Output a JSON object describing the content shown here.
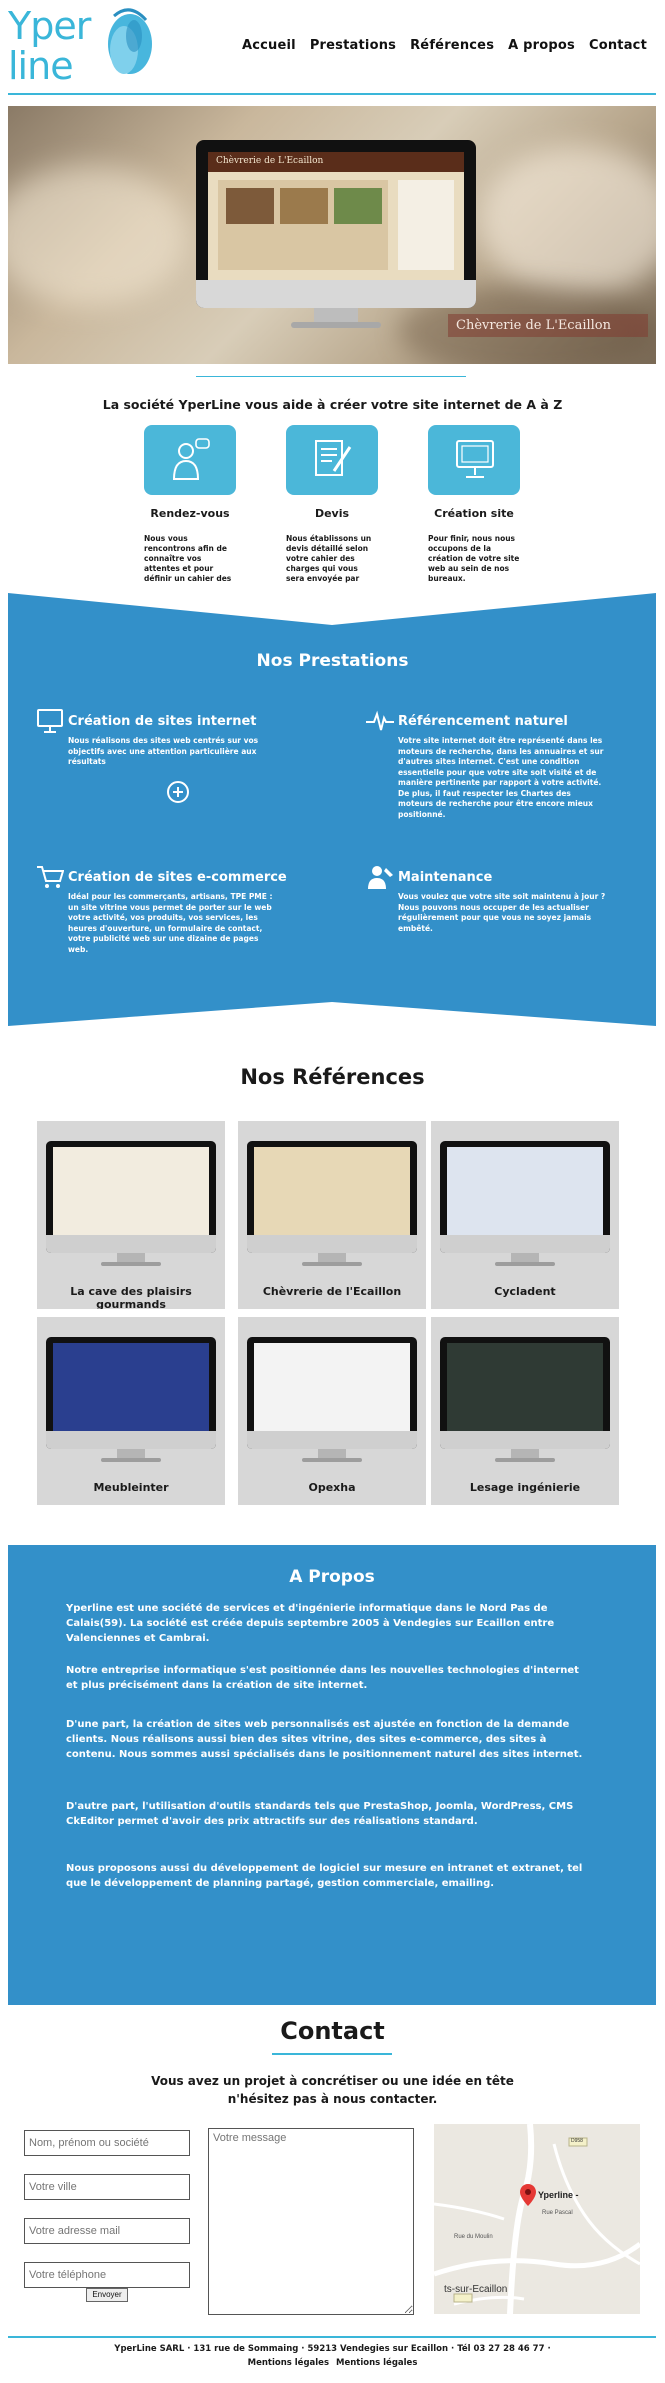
{
  "header": {
    "logo_text_top": "Yper",
    "logo_text_bottom": "line",
    "nav": [
      "Accueil",
      "Prestations",
      "Références",
      "A propos",
      "Contact"
    ]
  },
  "hero": {
    "caption": "Chèvrerie de L'Ecaillon",
    "screen_title": "Chèvrerie de L'Ecaillon"
  },
  "intro": {
    "title": "La société YperLine vous aide à créer votre site internet de A à Z",
    "features": [
      {
        "icon": "person-chat-icon",
        "title": "Rendez-vous",
        "text": "Nous vous rencontrons afin de connaître vos attentes et pour définir un cahier des"
      },
      {
        "icon": "document-pen-icon",
        "title": "Devis",
        "text": "Nous établissons un devis détaillé selon votre cahier des charges qui vous sera envoyée par email."
      },
      {
        "icon": "monitor-icon",
        "title": "Création site",
        "text": "Pour finir, nous nous occupons de la création de votre site web au sein de nos bureaux."
      }
    ]
  },
  "prestations": {
    "title": "Nos Prestations",
    "services": [
      {
        "icon": "computer-icon",
        "title": "Création de sites internet",
        "text": "Nous réalisons des sites web centrés sur vos objectifs avec une attention particulière aux résultats"
      },
      {
        "icon": "heartbeat-icon",
        "title": "Référencement naturel",
        "text": "Votre site internet doit être représenté dans les moteurs de recherche, dans les annuaires et sur d'autres sites internet. C'est une condition essentielle pour que votre site soit visité et de manière pertinente par rapport à votre activité. De plus, il faut respecter les Chartes des moteurs de recherche pour être encore mieux positionné."
      },
      {
        "icon": "cart-icon",
        "title": "Création de sites e-commerce",
        "text": "Idéal pour les commerçants, artisans, TPE PME : un site vitrine vous permet de porter sur le web votre activité, vos produits, vos services, les heures d'ouverture, un formulaire de contact, votre publicité web sur une dizaine de pages web."
      },
      {
        "icon": "maintenance-icon",
        "title": "Maintenance",
        "text": "Vous voulez que votre site soit maintenu à jour ? Nous pouvons nous occuper de les actualiser régulièrement pour que vous ne soyez jamais embêté."
      }
    ]
  },
  "references": {
    "title": "Nos Références",
    "items": [
      {
        "label": "La cave des plaisirs gourmands",
        "screen_color": "#f2ecdf"
      },
      {
        "label": "Chèvrerie de l'Ecaillon",
        "screen_color": "#e7d8b6"
      },
      {
        "label": "Cycladent",
        "screen_color": "#dde4ef"
      },
      {
        "label": "Meubleinter",
        "screen_color": "#2a3f8f"
      },
      {
        "label": "Opexha",
        "screen_color": "#f3f3f3"
      },
      {
        "label": "Lesage ingénierie",
        "screen_color": "#2f3a34"
      }
    ]
  },
  "apropos": {
    "title": "A Propos",
    "paragraphs": [
      "Yperline est une société de services et d'ingénierie informatique dans le Nord Pas de Calais(59). La société est créée depuis septembre 2005 à Vendegies sur Ecaillon entre Valenciennes et Cambrai.",
      "Notre entreprise informatique s'est positionnée dans les nouvelles technologies d'internet et plus précisément dans la création de site internet.",
      "D'une part, la création de sites web personnalisés est ajustée en fonction de la demande clients. Nous réalisons aussi bien des sites vitrine, des sites e-commerce, des sites à contenu. Nous sommes aussi spécialisés dans le positionnement naturel des sites internet.",
      "D'autre part, l'utilisation d'outils standards tels que PrestaShop, Joomla, WordPress, CMS CkEditor permet d'avoir des prix attractifs sur des réalisations standard.",
      "Nous proposons aussi du développement de logiciel sur mesure en intranet et extranet, tel que le développement de planning partagé, gestion commerciale, emailing."
    ]
  },
  "contact": {
    "title": "Contact",
    "subtitle_line1": "Vous avez un projet à concrétiser ou une idée en tête",
    "subtitle_line2": "n'hésitez pas à nous contacter.",
    "fields": {
      "name_placeholder": "Nom, prénom ou société",
      "city_placeholder": "Votre ville",
      "email_placeholder": "Votre adresse mail",
      "phone_placeholder": "Votre téléphone",
      "message_placeholder": "Votre message"
    },
    "send_label": "Envoyer",
    "map": {
      "place": "Yperline -",
      "road_label": "D958",
      "town": "ts-sur-Ecaillon",
      "street_labels": [
        "Rue Pascal",
        "Rue du Moulin"
      ]
    }
  },
  "footer": {
    "address": "YperLine SARL · 131 rue de Sommaing · 59213 Vendegies sur Ecaillon · Tél 03 27 28 46 77 ·",
    "links": [
      "Mentions légales",
      "Mentions légales"
    ]
  },
  "colors": {
    "accent": "#3ab6d9",
    "section_blue": "#3390c9"
  }
}
